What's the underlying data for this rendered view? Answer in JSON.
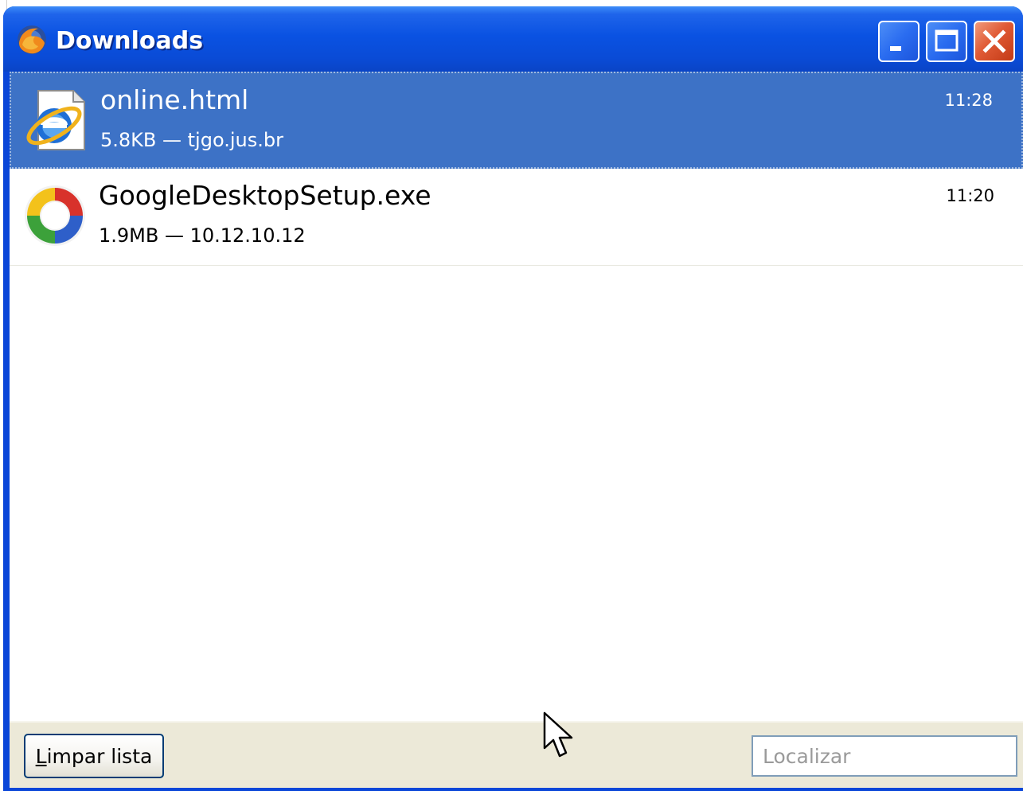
{
  "window": {
    "title": "Downloads",
    "app_icon": "firefox-icon",
    "controls": [
      "minimize-icon",
      "maximize-icon",
      "close-icon"
    ]
  },
  "downloads": [
    {
      "name": "online.html",
      "meta": "5.8KB — tjgo.jus.br",
      "time": "11:28",
      "icon": "internet-explorer-document-icon",
      "selected": true
    },
    {
      "name": "GoogleDesktopSetup.exe",
      "meta": "1.9MB — 10.12.10.12",
      "time": "11:20",
      "icon": "google-desktop-icon",
      "selected": false
    }
  ],
  "footer": {
    "clear_label_accel": "L",
    "clear_label_rest": "impar lista",
    "search_placeholder": "Localizar"
  },
  "colors": {
    "titlebar": "#0a52e2",
    "selection": "#3d72c6",
    "footer": "#ece9d8"
  }
}
